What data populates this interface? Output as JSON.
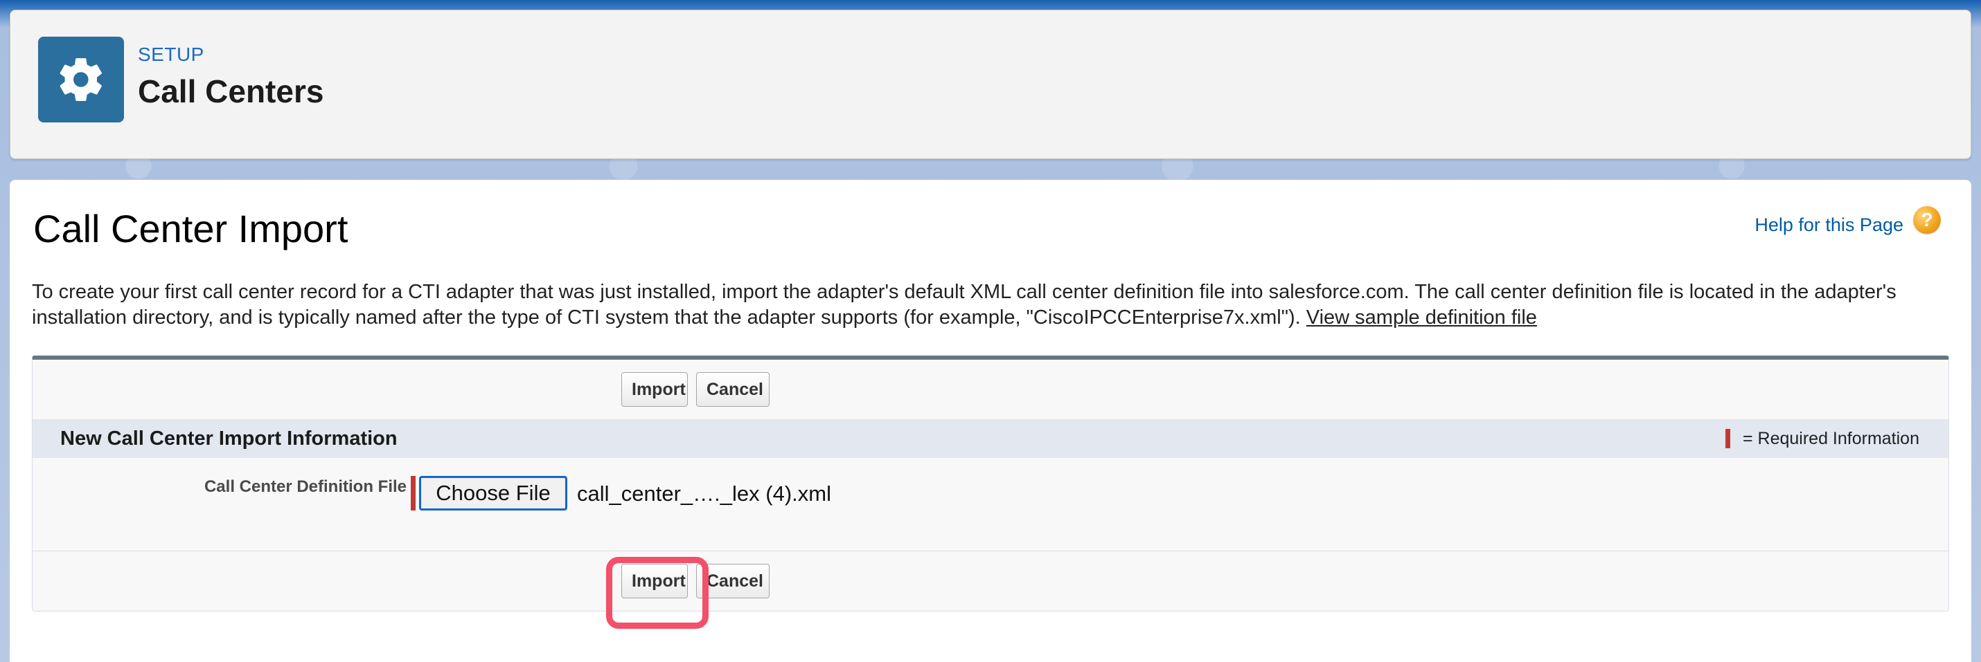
{
  "header": {
    "eyebrow": "SETUP",
    "title": "Call Centers",
    "icon": "gear-icon"
  },
  "page": {
    "title": "Call Center Import",
    "help_link": "Help for this Page",
    "help_icon": "?",
    "intro_text": "To create your first call center record for a CTI adapter that was just installed, import the adapter's default XML call center definition file into salesforce.com. The call center definition file is located in the adapter's installation directory, and is typically named after the type of CTI system that the adapter supports (for example, \"CiscoIPCCEnterprise7x.xml\"). ",
    "intro_link": "View sample definition file"
  },
  "form": {
    "buttons": {
      "import_label": "Import",
      "cancel_label": "Cancel"
    },
    "section_title": "New Call Center Import Information",
    "required_legend": "= Required Information",
    "field_label": "Call Center Definition File",
    "choose_file_label": "Choose File",
    "file_name": "call_center_…._lex (4).xml"
  },
  "colors": {
    "accent": "#1b6ac0",
    "header_icon_bg": "#2a6f9e",
    "required": "#c23934",
    "highlight": "#f2506b"
  }
}
